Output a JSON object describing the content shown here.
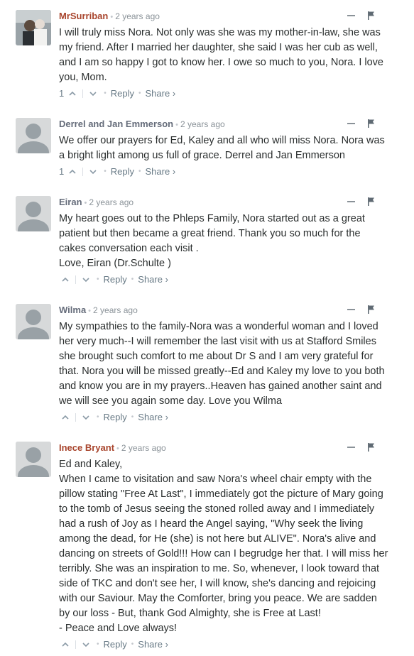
{
  "comments": [
    {
      "author": "MrSurriban",
      "time": "2 years ago",
      "upvotes": "1",
      "avatar": "photo-avatar",
      "body": [
        "I will truly miss Nora. Not only was she was my mother-in-law, she was my friend. After I married her daughter, she said I was her cub as well, and I am so happy I got to know her. I owe so much to you, Nora. I love you, Mom."
      ]
    },
    {
      "author": "Derrel and Jan Emmerson",
      "time": "2 years ago",
      "upvotes": "1",
      "avatar": "default-avatar",
      "body": [
        "We offer our prayers for Ed, Kaley and all who will miss Nora. Nora was a bright light among us full of grace. Derrel and Jan Emmerson"
      ]
    },
    {
      "author": "Eiran",
      "time": "2 years ago",
      "upvotes": "",
      "avatar": "default-avatar",
      "body": [
        "My heart goes out to the Phleps Family, Nora started out as a great patient but then became a great friend. Thank you so much for the cakes conversation each visit .",
        "Love, Eiran (Dr.Schulte )"
      ]
    },
    {
      "author": "Wilma",
      "time": "2 years ago",
      "upvotes": "",
      "avatar": "default-avatar",
      "body": [
        "My sympathies to the family-Nora was a wonderful woman and I loved her very much--I will remember the last visit with us at Stafford Smiles she brought such comfort to me about Dr S and I am very grateful for that. Nora you will be missed greatly--Ed and Kaley my love to you both and know you are in my prayers..Heaven has gained another saint and we will see you again some day. Love you Wilma"
      ]
    },
    {
      "author": "Inece Bryant",
      "time": "2 years ago",
      "upvotes": "",
      "avatar": "default-avatar",
      "body": [
        "Ed and Kaley,",
        "When I came to visitation and saw Nora's wheel chair empty with the pillow stating \"Free At Last\", I immediately got the picture of Mary going to the tomb of Jesus seeing the stoned rolled away and I immediately had a rush of Joy as I heard the Angel saying, \"Why seek the living among the dead, for He (she) is not here but ALIVE\". Nora's alive and dancing on streets of Gold!!! How can I begrudge her that. I will miss her terribly. She was an inspiration to me. So, whenever, I look toward that side of TKC and don't see her, I will know, she's dancing and rejoicing with our Saviour. May the Comforter, bring you peace. We are sadden by our loss - But, thank God Almighty, she is Free at Last!",
        "- Peace and Love always!"
      ]
    }
  ],
  "labels": {
    "reply": "Reply",
    "share": "Share ›",
    "bullet": "•"
  },
  "colors": {
    "author_highlight": "#a8442c",
    "author_default": "#656c7a",
    "meta": "#687a86",
    "text": "#2a2e2e"
  }
}
